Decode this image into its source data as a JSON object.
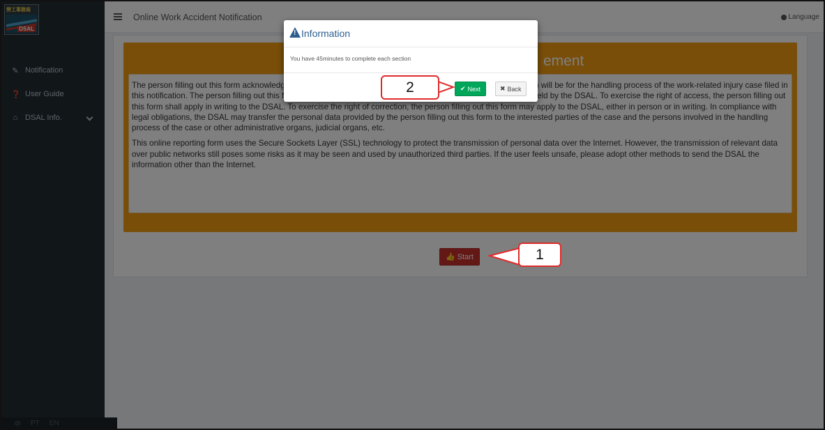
{
  "sidebar": {
    "logo_text": "勞工事務局",
    "logo_word": "DSAL",
    "items": [
      {
        "label": "Notification",
        "icon": "edit-icon"
      },
      {
        "label": "User Guide",
        "icon": "question-circle-icon"
      },
      {
        "label": "DSAL Info.",
        "icon": "home-icon"
      }
    ],
    "languages": [
      "中",
      "PT",
      "EN"
    ]
  },
  "topbar": {
    "title": "Online Work Accident Notification",
    "language_label": "Language"
  },
  "main": {
    "panel_title_visible": "ement",
    "paragraph1": "The person filling out this form acknowledges that the personal data provided to the Labour Affairs Bureau (DSAL) will be for the handling process of the work-related injury case filed in this notification. The person filling out this form has the right of access to and correction of his/her personal data held by the DSAL. To exercise the right of access, the person filling out this form shall apply in writing to the DSAL. To exercise the right of correction, the person filling out this form may apply to the DSAL, either in person or in writing. In compliance with legal obligations, the DSAL may transfer the personal data provided by the person filling out this form to the interested parties of the case and the persons involved in the handling process of the case or other administrative organs, judicial organs, etc.",
    "paragraph2": "This online reporting form uses the Secure Sockets Layer (SSL) technology to protect the transmission of personal data over the Internet. However, the transmission of relevant data over public networks still poses some risks as it may be seen and used by unauthorized third parties. If the user feels unsafe, please adopt other methods to send the DSAL the information other than the Internet.",
    "start_label": "Start"
  },
  "modal": {
    "title": "Information",
    "body": "You have 45minutes to complete each section",
    "next_label": "Next",
    "back_label": "Back"
  },
  "callouts": {
    "one": "1",
    "two": "2"
  },
  "colors": {
    "sidebar_bg": "#222d32",
    "panel_orange": "#f39c12",
    "start_red": "#c9302c",
    "next_green": "#00a65a",
    "modal_title_blue": "#2c5d8f",
    "callout_red": "#e02a2a"
  }
}
